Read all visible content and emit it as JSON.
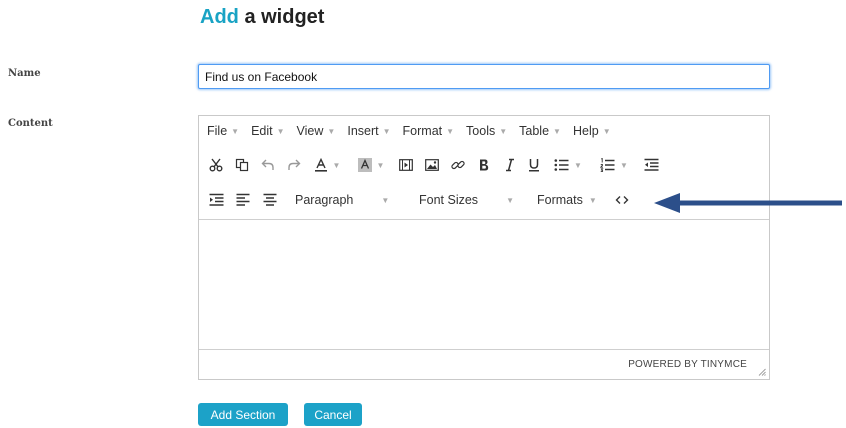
{
  "page": {
    "title_accent": "Add",
    "title_rest": " a widget"
  },
  "form": {
    "name_label": "Name",
    "name_value": "Find us on Facebook",
    "content_label": "Content"
  },
  "editor": {
    "menus": [
      "File",
      "Edit",
      "View",
      "Insert",
      "Format",
      "Tools",
      "Table",
      "Help"
    ],
    "toolbar_row1": [
      "cut-icon",
      "copy-icon",
      "undo-icon",
      "redo-icon",
      "text-color-icon",
      "background-color-icon",
      "media-icon",
      "image-icon",
      "link-icon",
      "bold-icon",
      "italic-icon",
      "underline-icon",
      "bullet-list-icon",
      "numbered-list-icon",
      "outdent-icon"
    ],
    "toolbar_row2": [
      "indent-icon",
      "align-left-icon",
      "align-center-icon",
      "code-icon"
    ],
    "paragraph_label": "Paragraph",
    "font_sizes_label": "Font Sizes",
    "formats_label": "Formats",
    "powered_by": "POWERED BY TINYMCE"
  },
  "buttons": {
    "add_section": "Add Section",
    "cancel": "Cancel"
  },
  "colors": {
    "accent": "#19a3c4",
    "button": "#1ca2c8",
    "arrow": "#2c4f8a",
    "focus_border": "#4f9bf3"
  }
}
